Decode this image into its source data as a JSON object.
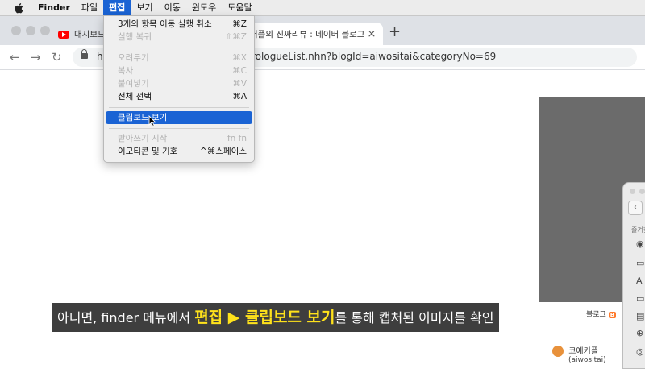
{
  "menubar": {
    "items": [
      {
        "label": "Finder",
        "bold": true
      },
      {
        "label": "파일"
      },
      {
        "label": "편집",
        "active": true
      },
      {
        "label": "보기"
      },
      {
        "label": "이동"
      },
      {
        "label": "윈도우"
      },
      {
        "label": "도움말"
      }
    ]
  },
  "browser": {
    "tab1_title": "대시보드",
    "tab2_title": "커플의 진짜리뷰 : 네이버 블로그",
    "tab2_close": "×",
    "new_tab": "+",
    "url_prefix": "h",
    "url_rest": "rologueList.nhn?blogId=aiwositai&categoryNo=69"
  },
  "edit_menu": {
    "items": [
      {
        "label": "3개의 항목 이동 실행 취소",
        "shortcut": "⌘Z",
        "enabled": true
      },
      {
        "label": "실행 복귀",
        "shortcut": "⇧⌘Z",
        "enabled": false
      },
      {
        "separator": true
      },
      {
        "label": "오려두기",
        "shortcut": "⌘X",
        "enabled": false
      },
      {
        "label": "복사",
        "shortcut": "⌘C",
        "enabled": false
      },
      {
        "label": "붙여넣기",
        "shortcut": "⌘V",
        "enabled": false
      },
      {
        "label": "전체 선택",
        "shortcut": "⌘A",
        "enabled": true
      },
      {
        "separator": true
      },
      {
        "label": "클립보드 보기",
        "shortcut": "",
        "enabled": true,
        "highlighted": true
      },
      {
        "separator": true
      },
      {
        "label": "받아쓰기 시작",
        "shortcut": "fn fn",
        "enabled": false
      },
      {
        "label": "이모티콘 및 기호",
        "shortcut": "^⌘스페이스",
        "enabled": true
      }
    ]
  },
  "finder_sidebar": {
    "favorites_label": "즐겨찾"
  },
  "blog": {
    "tag_text": "블로그",
    "tag_badge": "B",
    "user_name": "코예커플",
    "user_id": "(aiwositai)"
  },
  "caption": {
    "part1": "아니면, finder 메뉴에서 ",
    "highlight": "편집 ▶ 클립보드 보기",
    "part2": "를 통해 캡처된 이미지를 확인"
  },
  "colors": {
    "menu_highlight": "#1a63d4",
    "caption_highlight": "#ffe21b"
  }
}
